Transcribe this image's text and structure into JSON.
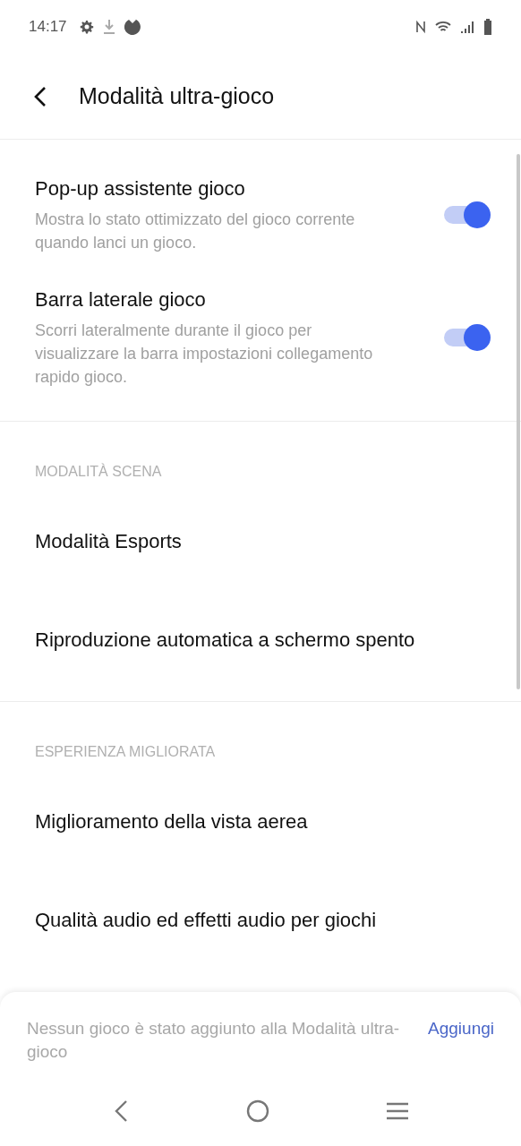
{
  "status_bar": {
    "time": "14:17"
  },
  "header": {
    "title": "Modalità ultra-gioco"
  },
  "sections": [
    {
      "items": [
        {
          "kind": "toggle",
          "title": "Pop-up assistente gioco",
          "description": "Mostra lo stato ottimizzato del gioco corrente quando lanci un gioco.",
          "on": true
        },
        {
          "kind": "toggle",
          "title": "Barra laterale gioco",
          "description": "Scorri lateralmente durante il gioco per visualizzare la barra impostazioni collegamento rapido gioco.",
          "on": true
        }
      ]
    },
    {
      "heading": "MODALITÀ SCENA",
      "items": [
        {
          "kind": "link",
          "title": "Modalità Esports"
        },
        {
          "kind": "link",
          "title": "Riproduzione automatica a schermo spento"
        }
      ]
    },
    {
      "heading": "ESPERIENZA MIGLIORATA",
      "items": [
        {
          "kind": "link",
          "title": "Miglioramento della vista aerea"
        },
        {
          "kind": "link",
          "title": "Qualità audio ed effetti audio per giochi"
        }
      ]
    }
  ],
  "bottom_sheet": {
    "message": "Nessun gioco è stato aggiunto alla Modalità ultra-gioco",
    "action": "Aggiungi"
  }
}
